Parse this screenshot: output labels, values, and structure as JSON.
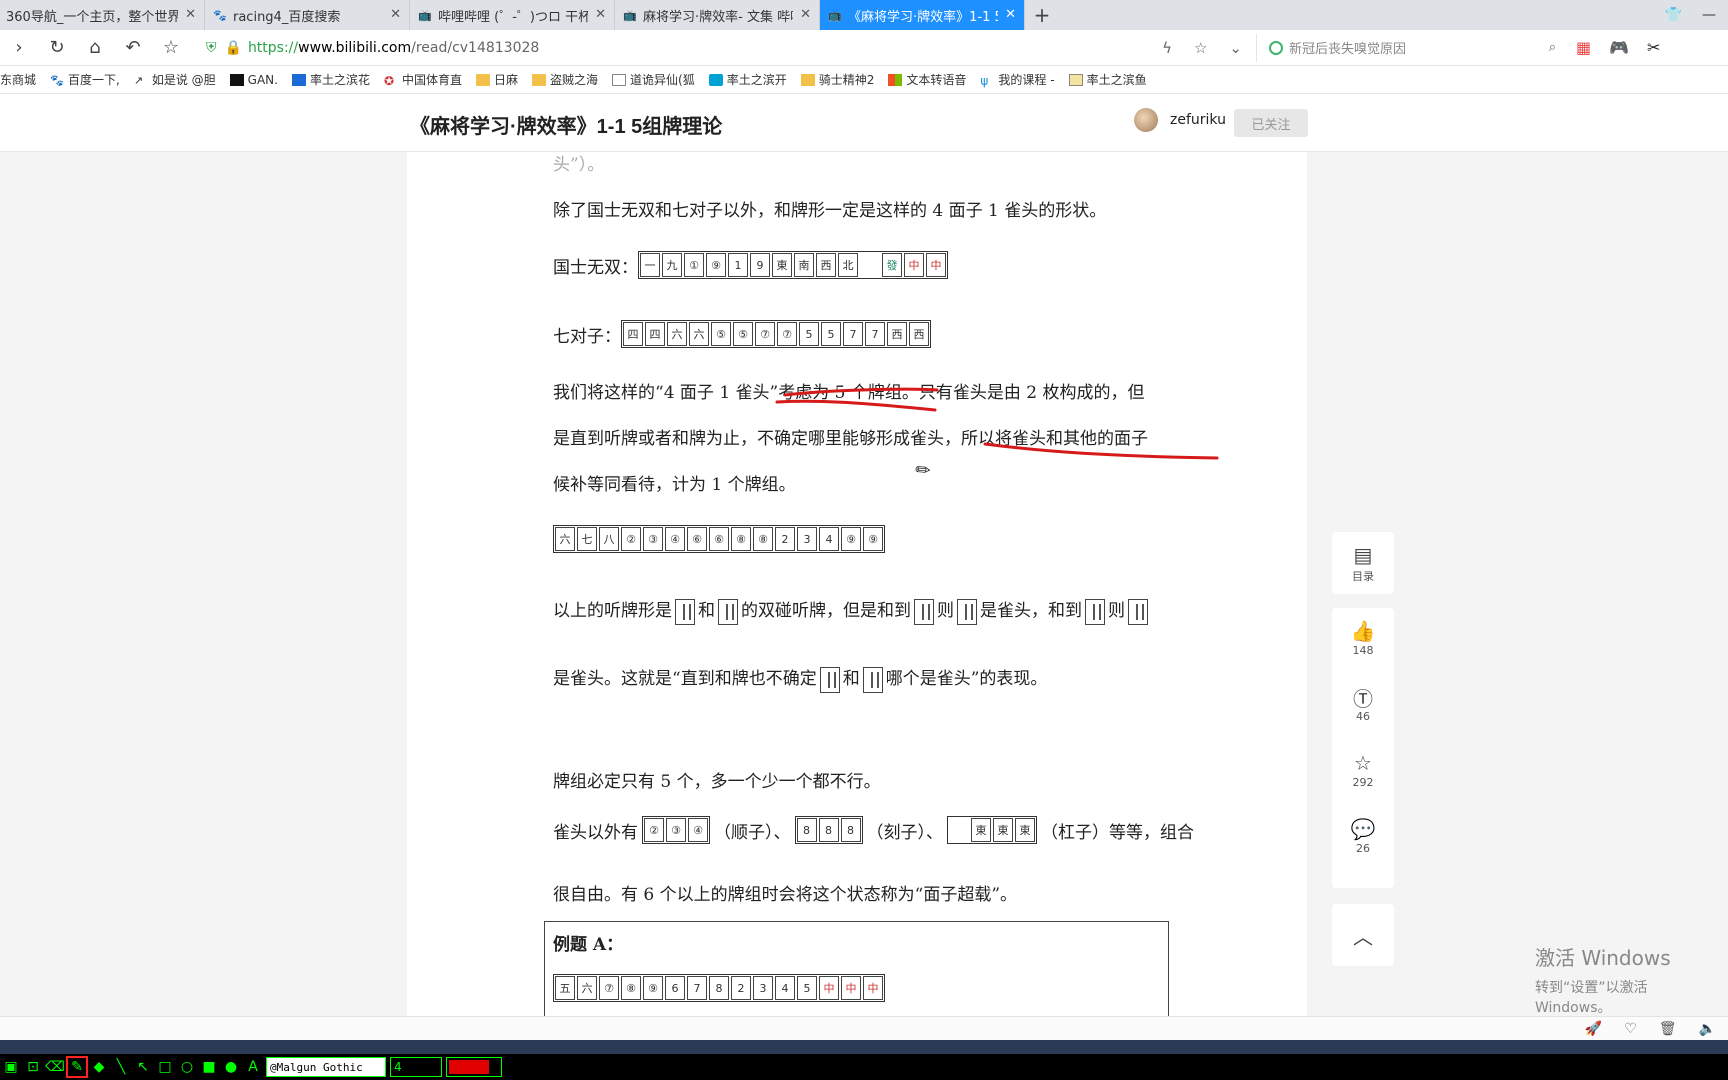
{
  "tabs": [
    {
      "label": "360导航_一个主页，整个世界",
      "icon": "360-icon",
      "active": false
    },
    {
      "label": "racing4_百度搜索",
      "icon": "baidu-icon",
      "active": false
    },
    {
      "label": "哔哩哔哩 (゜-゜)つロ 干杯~-bi",
      "icon": "bilibili-icon",
      "active": false
    },
    {
      "label": "麻将学习·牌效率- 文集 哔哩哔哩",
      "icon": "bilibili-icon",
      "active": false
    },
    {
      "label": "《麻将学习·牌效率》1-1 5组牌",
      "icon": "bilibili-icon",
      "active": true
    }
  ],
  "address": {
    "scheme": "https://",
    "host": "www.bilibili.com",
    "path": "/read/cv14813028",
    "search_placeholder": "新冠后丧失嗅觉原因"
  },
  "bookmarks": [
    {
      "label": "东商城",
      "icon": "page-icon"
    },
    {
      "label": "百度一下,",
      "icon": "baidu-icon"
    },
    {
      "label": "如是说 @胆",
      "icon": "page-icon"
    },
    {
      "label": "GAN.",
      "icon": "gan-icon"
    },
    {
      "label": "率土之滨花",
      "icon": "zhihu-icon"
    },
    {
      "label": "中国体育直",
      "icon": "star-icon"
    },
    {
      "label": "日麻",
      "icon": "folder-icon"
    },
    {
      "label": "盗贼之海",
      "icon": "folder-icon"
    },
    {
      "label": "道诡异仙(狐",
      "icon": "page-icon"
    },
    {
      "label": "率土之滨开",
      "icon": "bilibili-icon"
    },
    {
      "label": "骑士精神2",
      "icon": "folder-icon"
    },
    {
      "label": "文本转语音",
      "icon": "microsoft-icon"
    },
    {
      "label": "我的课程 -",
      "icon": "course-icon"
    },
    {
      "label": "率土之滨鱼",
      "icon": "page-icon"
    }
  ],
  "article": {
    "title": "《麻将学习·牌效率》1-1 5组牌理论",
    "author": "zefuriku",
    "follow_label": "已关注",
    "p_cut": "头”）。",
    "p1": "除了国士无双和七对子以外，和牌形一定是这样的 4 面子 1 雀头的形状。",
    "kokushi_label": "国士无双：",
    "chiitoi_label": "七对子：",
    "p2a": "我们将这样的“4 面子 1 雀头”考虑为 5 个牌组。只有雀头是由 2 枚构成的，但",
    "p2b": "是直到听牌或者和牌为止，不确定哪里能够形成雀头，所以将雀头和其他的面子",
    "p2c": "候补等同看待，计为 1 个牌组。",
    "p3a_1": "以上的听牌形是",
    "p3a_2": "和",
    "p3a_3": "的双碰听牌，但是和到",
    "p3a_4": "则",
    "p3a_5": "是雀头，和到",
    "p3a_6": "则",
    "p3b_1": "是雀头。这就是“直到和牌也不确定",
    "p3b_2": "和",
    "p3b_3": "哪个是雀头”的表现。",
    "p4": "牌组必定只有 5 个，多一个少一个都不行。",
    "p5_1": "雀头以外有",
    "p5_2": "（顺子）、",
    "p5_3": "（刻子）、",
    "p5_4": "（杠子）等等，组合",
    "p6": "很自由。有 6 个以上的牌组时会将这个状态称为“面子超载”。",
    "example_title": "例题 A：",
    "kokushi_tiles": [
      "一",
      "九",
      "①",
      "⑨",
      "1",
      "9",
      "東",
      "南",
      "西",
      "北",
      "",
      "發",
      "中",
      "中"
    ],
    "chiitoi_tiles": [
      "四",
      "四",
      "六",
      "六",
      "⑤",
      "⑤",
      "⑦",
      "⑦",
      "5",
      "5",
      "7",
      "7",
      "西",
      "西"
    ],
    "hand_tiles": [
      "六",
      "七",
      "八",
      "②",
      "③",
      "④",
      "⑥",
      "⑥",
      "⑧",
      "⑧",
      "2",
      "3",
      "4",
      "⑨",
      "⑨"
    ],
    "shuntsu_tiles": [
      "②",
      "③",
      "④"
    ],
    "koutsu_tiles": [
      "8",
      "8",
      "8"
    ],
    "kantsu_tiles": [
      "",
      "東",
      "東",
      "東"
    ],
    "example_tiles": [
      "五",
      "六",
      "⑦",
      "⑧",
      "⑨",
      "6",
      "7",
      "8",
      "2",
      "3",
      "4",
      "5",
      "中",
      "中",
      "中"
    ]
  },
  "sidebar": {
    "toc_label": "目录",
    "likes": "148",
    "coins": "46",
    "favorites": "292",
    "comments": "26"
  },
  "watermark": {
    "line1": "激活 Windows",
    "line2": "转到“设置”以激活 Windows。"
  },
  "drawtool": {
    "font": "@Malgun Gothic",
    "size": "4",
    "color": "#e00000"
  },
  "annotation_color": "#d61a1a"
}
